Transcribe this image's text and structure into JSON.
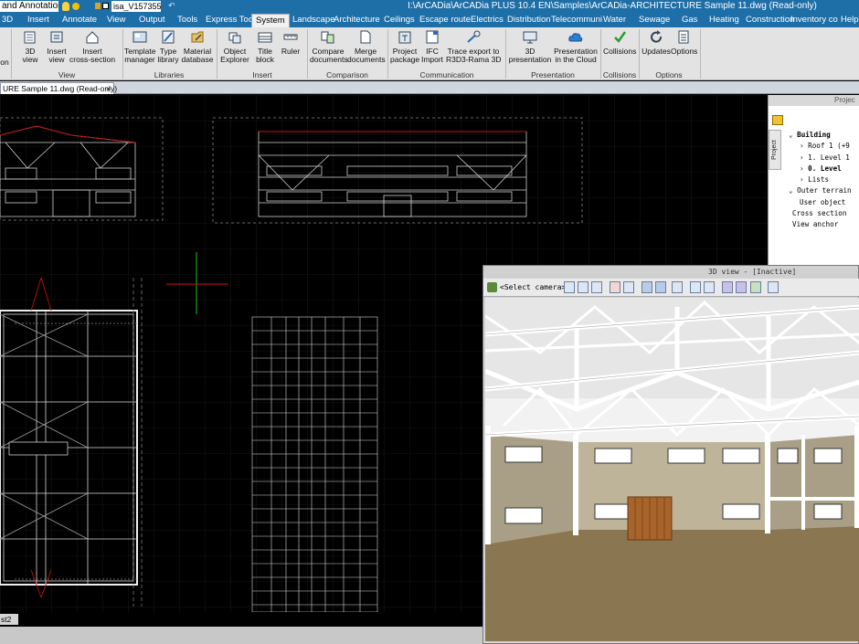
{
  "titlebar": {
    "workspace": "and Annotation",
    "layer": "isa_V157355",
    "title": "I:\\ArCADia\\ArCADia PLUS 10.4 EN\\Samples\\ArCADia-ARCHITECTURE Sample 11.dwg (Read-only)"
  },
  "menu": {
    "items": [
      "3D",
      "Insert",
      "Annotate",
      "View",
      "Output",
      "Tools",
      "Express Tools",
      "System",
      "Landscape",
      "Architecture",
      "Ceilings",
      "Escape route",
      "Electrics",
      "Distribution",
      "Telecommuni",
      "Water",
      "Sewage",
      "Gas",
      "Heating",
      "Construction",
      "Inventory co",
      "Help"
    ],
    "active": "System"
  },
  "ribbon": {
    "view_group": {
      "label": "View",
      "btn_3d": "3D\nview",
      "btn_insert_view": "Insert\nview",
      "btn_insert_cross": "Insert\ncross-section"
    },
    "libraries_group": {
      "label": "Libraries",
      "btn_template": "Template\nmanager",
      "btn_type": "Type\nlibrary",
      "btn_material": "Material\ndatabase"
    },
    "insert_group": {
      "label": "Insert",
      "btn_object_explorer": "Object\nExplorer",
      "btn_title_block": "Title\nblock",
      "btn_ruler": "Ruler"
    },
    "comparison_group": {
      "label": "Comparison",
      "btn_compare": "Compare\ndocuments",
      "btn_merge": "Merge\ndocuments"
    },
    "communication_group": {
      "label": "Communication",
      "btn_project_package": "Project\npackage",
      "btn_ifc": "IFC\nImport",
      "btn_trace": "Trace export to\nR3D3-Rama 3D"
    },
    "presentation_group": {
      "label": "Presentation",
      "btn_3d_presentation": "3D\npresentation",
      "btn_cloud": "Presentation\nin the Cloud"
    },
    "collisions_group": {
      "label": "Collisions",
      "btn_collisions": "Collisions"
    },
    "options_group": {
      "label": "Options",
      "btn_updates": "Updates",
      "btn_options": "Options"
    },
    "cut_left_label": "on"
  },
  "doc_tab": {
    "label": "URE Sample 11.dwg (Read-only)",
    "close": "×"
  },
  "layout_tab": "st2",
  "project_panel": {
    "header": "Projec",
    "vtab": "Project",
    "tree": [
      "Building",
      "Roof 1 (+9",
      "1. Level 1",
      "0. Level",
      "Lists",
      "Outer terrain",
      "User object",
      "Cross section",
      "View anchor"
    ]
  },
  "view3d": {
    "title": "3D view - [Inactive]",
    "camera": "<Select camera>"
  },
  "colors": {
    "title_bar": "#1e6fa8",
    "canvas": "#000000",
    "ribbon": "#e3e3e3",
    "cad_red": "#d01010",
    "cad_green": "#20c020"
  }
}
